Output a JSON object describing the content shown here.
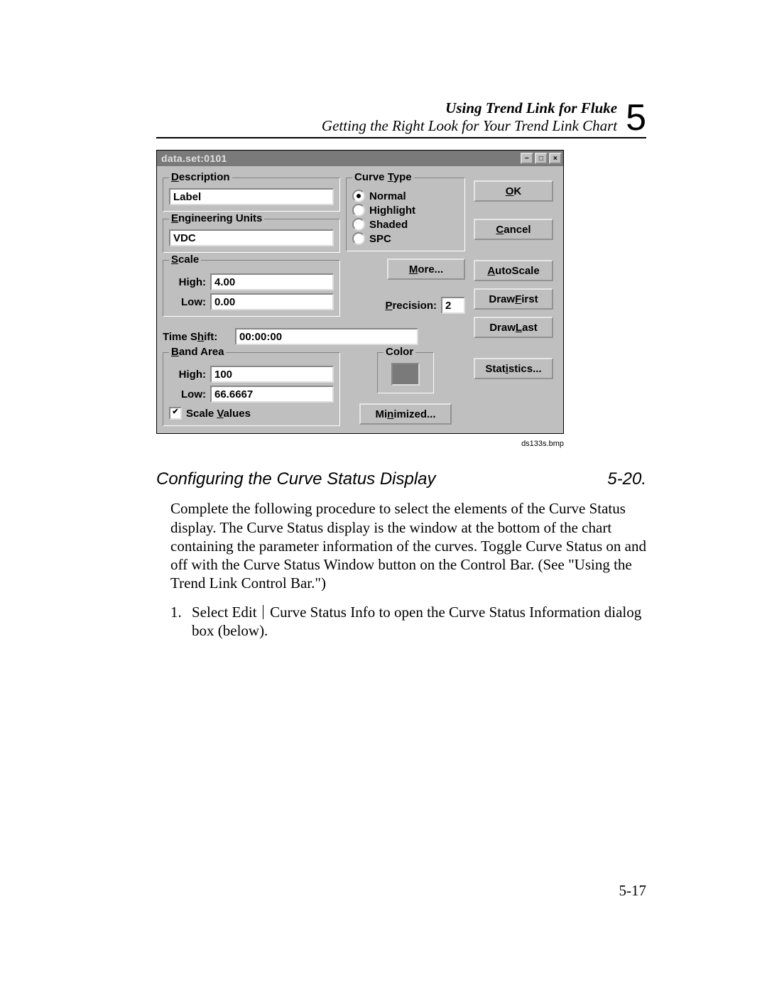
{
  "header": {
    "title_bold": "Using Trend Link for Fluke",
    "subtitle": "Getting the Right Look for Your Trend Link Chart",
    "chapter_number": "5"
  },
  "dialog": {
    "title": "data.set:0101",
    "groups": {
      "description": {
        "legend_pre": "",
        "legend_u": "D",
        "legend_post": "escription",
        "value": "Label"
      },
      "eng_units": {
        "legend_pre": "",
        "legend_u": "E",
        "legend_post": "ngineering Units",
        "value": "VDC"
      },
      "scale": {
        "legend_pre": "",
        "legend_u": "S",
        "legend_post": "cale",
        "high_label": "High:",
        "high_value": "4.00",
        "low_label": "Low:",
        "low_value": "0.00"
      },
      "curve_type": {
        "legend_pre": "Curve ",
        "legend_u": "T",
        "legend_post": "ype",
        "options": {
          "normal": "Normal",
          "highlight": "Highlight",
          "shaded": "Shaded",
          "spc": "SPC"
        },
        "selected": "normal"
      },
      "precision": {
        "label_pre": "",
        "label_u": "P",
        "label_post": "recision:",
        "value": "2"
      },
      "time_shift": {
        "label_pre": "Time S",
        "label_u": "h",
        "label_post": "ift:",
        "value": "00:00:00"
      },
      "band_area": {
        "legend_pre": "",
        "legend_u": "B",
        "legend_post": "and Area",
        "high_label": "High:",
        "high_value": "100",
        "low_label": "Low:",
        "low_value": "66.6667",
        "scale_values_pre": "Scale ",
        "scale_values_u": "V",
        "scale_values_post": "alues",
        "scale_values_checked": true
      },
      "color": {
        "legend": "Color"
      }
    },
    "buttons": {
      "ok_u": "O",
      "ok_post": "K",
      "cancel_u": "C",
      "cancel_post": "ancel",
      "more_pre": "",
      "more_u": "M",
      "more_post": "ore...",
      "autoscale_pre": "",
      "autoscale_u": "A",
      "autoscale_post": "utoScale",
      "drawfirst_pre": "Draw ",
      "drawfirst_u": "F",
      "drawfirst_post": "irst",
      "drawlast_pre": "Draw ",
      "drawlast_u": "L",
      "drawlast_post": "ast",
      "statistics_pre": "Stat",
      "statistics_u": "i",
      "statistics_post": "stics...",
      "minimized_pre": "Mi",
      "minimized_u": "n",
      "minimized_post": "imized..."
    }
  },
  "caption": "ds133s.bmp",
  "section": {
    "heading": "Configuring the Curve Status Display",
    "heading_num": "5-20."
  },
  "body": {
    "p1": "Complete the following procedure to select the elements of the Curve Status display. The Curve Status display is the window at the bottom of the chart containing the parameter information of the curves. Toggle Curve Status on and off with the Curve Status Window button on the Control Bar. (See \"Using the Trend Link Control Bar.\")",
    "li1_num": "1.",
    "li1_a": "Select Edit ",
    "li1_b": " Curve Status Info to open the Curve Status Information dialog box (below)."
  },
  "page_number": "5-17"
}
